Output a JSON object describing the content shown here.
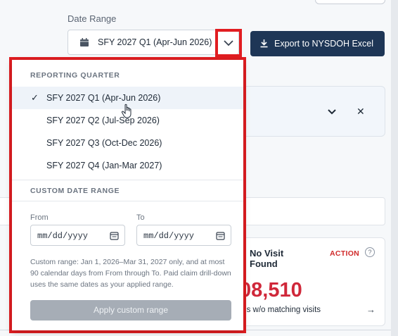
{
  "header": {
    "date_range_label": "Date Range",
    "selected_range": "SFY 2027 Q1 (Apr-Jun 2026)",
    "export_label": "Export to NYSDOH Excel"
  },
  "dropdown": {
    "quarter_heading": "REPORTING QUARTER",
    "quarters": [
      {
        "label": "SFY 2027 Q1 (Apr-Jun 2026)",
        "selected": true
      },
      {
        "label": "SFY 2027 Q2 (Jul-Sep 2026)",
        "selected": false
      },
      {
        "label": "SFY 2027 Q3 (Oct-Dec 2026)",
        "selected": false
      },
      {
        "label": "SFY 2027 Q4 (Jan-Mar 2027)",
        "selected": false
      }
    ],
    "check_mark": "✓",
    "custom_heading": "CUSTOM DATE RANGE",
    "from_label": "From",
    "to_label": "To",
    "from_placeholder": "mm/dd/yyyy",
    "to_placeholder": "mm/dd/yyyy",
    "help_text": "Custom range: Jan 1, 2026–Mar 31, 2027 only, and at most 90 calendar days from From through To. Paid claim drill-down uses the same dates as your applied range.",
    "apply_label": "Apply custom range"
  },
  "background": {
    "card_title": "No Visit Found",
    "card_badge": "ACTION",
    "card_help": "?",
    "card_value": "08,510",
    "card_sub": "ms w/o matching visits",
    "card_arrow": "→",
    "close_glyph": "✕"
  },
  "colors": {
    "highlight_red": "#e11d21",
    "export_bg": "#1e3656",
    "value_red": "#d0283a",
    "apply_disabled": "#a6adb6"
  }
}
